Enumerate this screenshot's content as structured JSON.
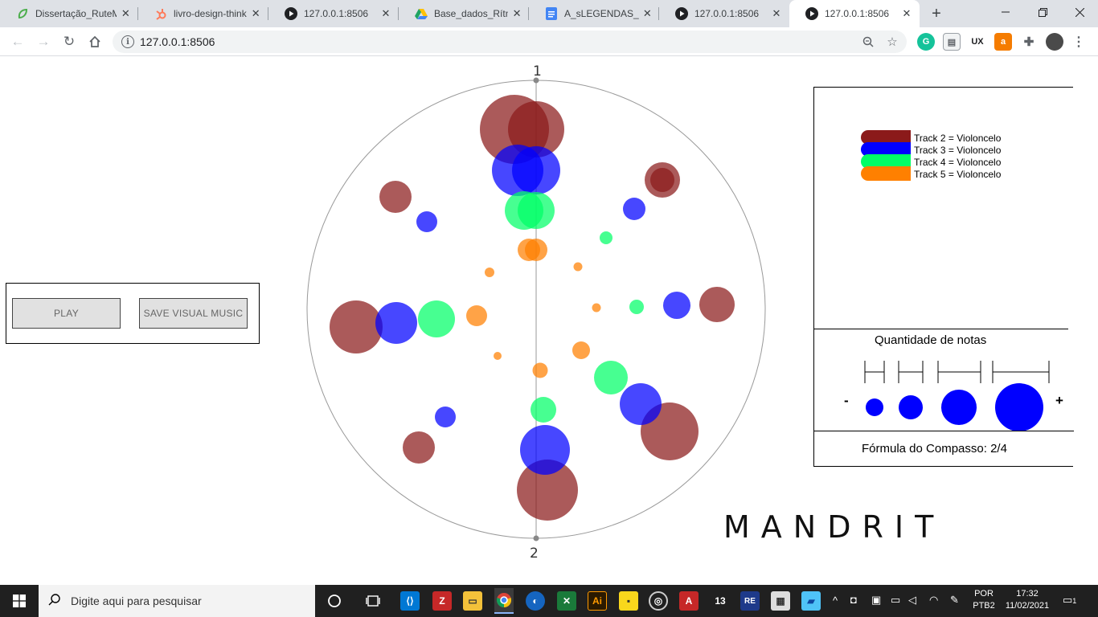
{
  "browser": {
    "tabs": [
      {
        "title": "Dissertação_RuteM",
        "icon": "overleaf-leaf-icon",
        "color": "#4cae4c"
      },
      {
        "title": "livro-design-thinki",
        "icon": "hubspot-icon",
        "color": "#ff7a59"
      },
      {
        "title": "127.0.0.1:8506",
        "icon": "play-circle-icon",
        "color": "#202124"
      },
      {
        "title": "Base_dados_Rítmic",
        "icon": "google-drive-icon",
        "color": "#1fa463"
      },
      {
        "title": "A_sLEGENDAS_MA",
        "icon": "google-docs-icon",
        "color": "#4285f4"
      },
      {
        "title": "127.0.0.1:8506",
        "icon": "play-circle-icon",
        "color": "#202124"
      },
      {
        "title": "127.0.0.1:8506",
        "icon": "play-circle-icon",
        "color": "#202124",
        "active": true
      }
    ],
    "url": "127.0.0.1:8506"
  },
  "controls": {
    "play_label": "PLAY",
    "save_label": "SAVE VISUAL MUSIC"
  },
  "visualization": {
    "beat_labels": [
      "1",
      "2"
    ],
    "tracks": [
      {
        "id": 2,
        "color": "#8b1a1a"
      },
      {
        "id": 3,
        "color": "#0000ff"
      },
      {
        "id": 4,
        "color": "#00ff66"
      },
      {
        "id": 5,
        "color": "#ff8000"
      }
    ]
  },
  "legend": {
    "items": [
      {
        "label": "Track 2 = Violoncelo",
        "color": "#8b1a1a"
      },
      {
        "label": "Track 3 = Violoncelo",
        "color": "#0000ff"
      },
      {
        "label": "Track 4 = Violoncelo",
        "color": "#00ff66"
      },
      {
        "label": "Track 5 = Violoncelo",
        "color": "#ff8000"
      }
    ],
    "quantity_title": "Quantidade de notas",
    "minus": "-",
    "plus": "+",
    "formula": "Fórmula do Compasso: 2/4"
  },
  "brand": "MANDRIT",
  "taskbar": {
    "search_placeholder": "Digite aqui para pesquisar",
    "lang_top": "POR",
    "lang_bottom": "PTB2",
    "time": "17:32",
    "date": "11/02/2021",
    "notifications": "1"
  }
}
